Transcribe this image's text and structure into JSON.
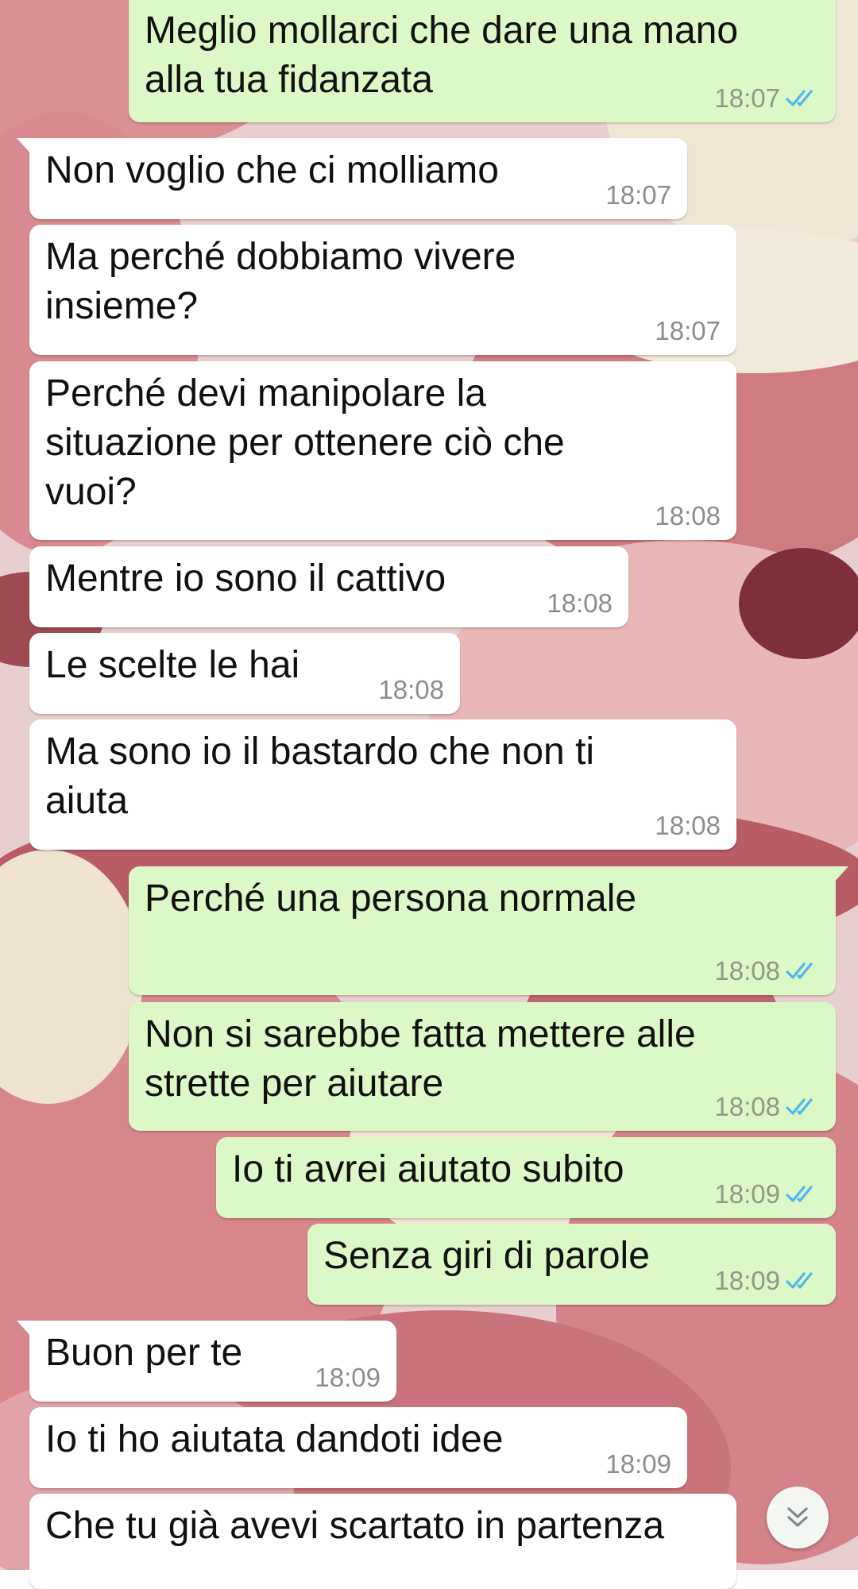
{
  "messages": [
    {
      "id": "m1",
      "direction": "out",
      "text": "Meglio mollarci che dare una mano\nalla tua fidanzata",
      "time": "18:07",
      "read": true
    },
    {
      "id": "m2",
      "direction": "in",
      "text": "Non voglio che ci molliamo",
      "time": "18:07"
    },
    {
      "id": "m3",
      "direction": "in",
      "text": "Ma perché dobbiamo vivere\ninsieme?",
      "time": "18:07"
    },
    {
      "id": "m4",
      "direction": "in",
      "text": "Perché devi manipolare la\nsituazione per ottenere ciò che\nvuoi?",
      "time": "18:08"
    },
    {
      "id": "m5",
      "direction": "in",
      "text": "Mentre io sono il cattivo",
      "time": "18:08"
    },
    {
      "id": "m6",
      "direction": "in",
      "text": "Le scelte le hai",
      "time": "18:08"
    },
    {
      "id": "m7",
      "direction": "in",
      "text": "Ma sono io il bastardo che non ti\naiuta",
      "time": "18:08"
    },
    {
      "id": "m8",
      "direction": "out",
      "text": "Perché una persona normale",
      "time": "18:08",
      "read": true
    },
    {
      "id": "m9",
      "direction": "out",
      "text": "Non si sarebbe fatta mettere alle\nstrette per aiutare",
      "time": "18:08",
      "read": true
    },
    {
      "id": "m10",
      "direction": "out",
      "text": "Io ti avrei aiutato subito",
      "time": "18:09",
      "read": true
    },
    {
      "id": "m11",
      "direction": "out",
      "text": "Senza giri di parole",
      "time": "18:09",
      "read": true
    },
    {
      "id": "m12",
      "direction": "in",
      "text": "Buon per te",
      "time": "18:09"
    },
    {
      "id": "m13",
      "direction": "in",
      "text": "Io ti ho aiutata dandoti idee",
      "time": "18:09"
    },
    {
      "id": "m14",
      "direction": "in",
      "text": "Che tu già avevi scartato in partenza",
      "time": ""
    }
  ],
  "icons": {
    "read_receipt": "double-check-icon",
    "scroll_down": "double-chevron-down-icon"
  },
  "colors": {
    "incoming_bubble": "#ffffff",
    "outgoing_bubble": "#dcf8c6",
    "read_ticks": "#4fb6ec",
    "timestamp": "#8a8f8a"
  }
}
